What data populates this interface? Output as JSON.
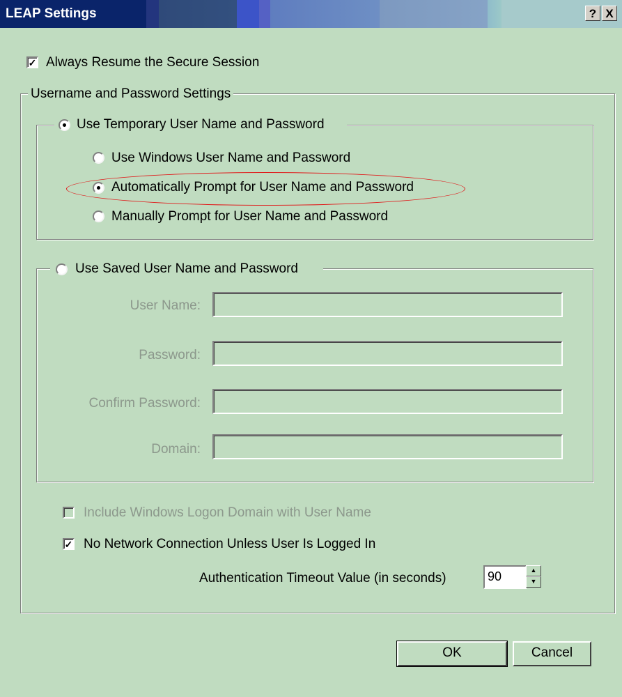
{
  "window": {
    "title": "LEAP Settings",
    "help_label": "?",
    "close_label": "X"
  },
  "always_resume": {
    "label": "Always Resume the Secure Session",
    "checked": true
  },
  "credentials_group": {
    "legend": "Username and Password Settings"
  },
  "temporary": {
    "label": "Use Temporary User Name and Password",
    "options": [
      {
        "label": "Use Windows User Name and Password"
      },
      {
        "label": "Automatically Prompt for User Name and Password"
      },
      {
        "label": "Manually Prompt for User Name and Password"
      }
    ]
  },
  "saved": {
    "label": "Use Saved User Name and Password",
    "fields": {
      "username": {
        "label": "User Name:",
        "value": ""
      },
      "password": {
        "label": "Password:",
        "value": ""
      },
      "confirm": {
        "label": "Confirm Password:",
        "value": ""
      },
      "domain": {
        "label": "Domain:",
        "value": ""
      }
    }
  },
  "include_domain": {
    "label": "Include Windows Logon Domain with User Name",
    "checked": false
  },
  "no_network": {
    "label": "No Network Connection Unless User Is Logged In",
    "checked": true
  },
  "timeout": {
    "label": "Authentication Timeout Value (in seconds)",
    "value": "90"
  },
  "buttons": {
    "ok": "OK",
    "cancel": "Cancel"
  },
  "annotation": {
    "color": "#e01a1a"
  }
}
